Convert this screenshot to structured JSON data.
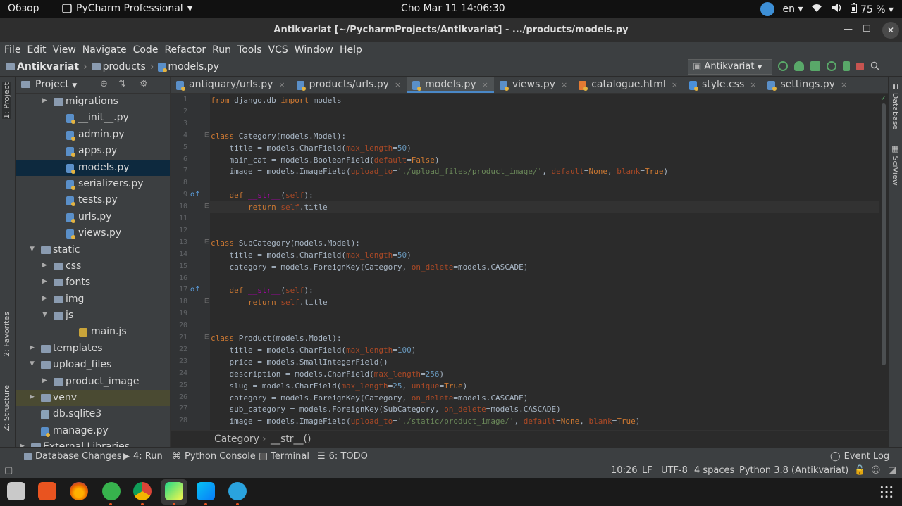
{
  "gnome": {
    "overview": "Обзор",
    "app_name": "PyCharm Professional",
    "clock": "Cho Mar 11  14:06:30",
    "lang": "en",
    "battery": "75 %"
  },
  "window": {
    "title": "Antikvariat [~/PycharmProjects/Antikvariat] - .../products/models.py"
  },
  "menu": [
    "File",
    "Edit",
    "View",
    "Navigate",
    "Code",
    "Refactor",
    "Run",
    "Tools",
    "VCS",
    "Window",
    "Help"
  ],
  "navbar": {
    "project": "Antikvariat",
    "folder": "products",
    "file": "models.py",
    "run_config": "Antikvariat"
  },
  "project_panel": {
    "title": "Project",
    "tree": [
      {
        "label": "migrations",
        "type": "folder",
        "level": 2,
        "expanded": false
      },
      {
        "label": "__init__.py",
        "type": "py",
        "level": 3
      },
      {
        "label": "admin.py",
        "type": "py",
        "level": 3
      },
      {
        "label": "apps.py",
        "type": "py",
        "level": 3
      },
      {
        "label": "models.py",
        "type": "py",
        "level": 3,
        "selected": true
      },
      {
        "label": "serializers.py",
        "type": "py",
        "level": 3
      },
      {
        "label": "tests.py",
        "type": "py",
        "level": 3
      },
      {
        "label": "urls.py",
        "type": "py",
        "level": 3
      },
      {
        "label": "views.py",
        "type": "py",
        "level": 3
      },
      {
        "label": "static",
        "type": "folder",
        "level": 1,
        "expanded": true
      },
      {
        "label": "css",
        "type": "folder",
        "level": 2,
        "expanded": false
      },
      {
        "label": "fonts",
        "type": "folder",
        "level": 2,
        "expanded": false
      },
      {
        "label": "img",
        "type": "folder",
        "level": 2,
        "expanded": false
      },
      {
        "label": "js",
        "type": "folder",
        "level": 2,
        "expanded": true
      },
      {
        "label": "main.js",
        "type": "js",
        "level": 4
      },
      {
        "label": "templates",
        "type": "folder",
        "level": 1,
        "expanded": false
      },
      {
        "label": "upload_files",
        "type": "folder",
        "level": 1,
        "expanded": true
      },
      {
        "label": "product_image",
        "type": "folder",
        "level": 2,
        "expanded": false
      },
      {
        "label": "venv",
        "type": "folder",
        "level": 1,
        "expanded": false,
        "venv": true
      },
      {
        "label": "db.sqlite3",
        "type": "db",
        "level": 1
      },
      {
        "label": "manage.py",
        "type": "py",
        "level": 1
      },
      {
        "label": "External Libraries",
        "type": "lib",
        "level": 0,
        "expanded": false
      }
    ]
  },
  "tabs": [
    {
      "label": "antiquary/urls.py",
      "active": false
    },
    {
      "label": "products/urls.py",
      "active": false
    },
    {
      "label": "models.py",
      "active": true
    },
    {
      "label": "views.py",
      "active": false
    },
    {
      "label": "catalogue.html",
      "active": false
    },
    {
      "label": "style.css",
      "active": false
    },
    {
      "label": "settings.py",
      "active": false
    }
  ],
  "code_lines": [
    "from django.db import models",
    "",
    "",
    "class Category(models.Model):",
    "    title = models.CharField(max_length=50)",
    "    main_cat = models.BooleanField(default=False)",
    "    image = models.ImageField(upload_to='./upload_files/product_image/', default=None, blank=True)",
    "",
    "    def __str__(self):",
    "        return self.title",
    "",
    "",
    "class SubCategory(models.Model):",
    "    title = models.CharField(max_length=50)",
    "    category = models.ForeignKey(Category, on_delete=models.CASCADE)",
    "",
    "    def __str__(self):",
    "        return self.title",
    "",
    "",
    "class Product(models.Model):",
    "    title = models.CharField(max_length=100)",
    "    price = models.SmallIntegerField()",
    "    description = models.CharField(max_length=256)",
    "    slug = models.CharField(max_length=25, unique=True)",
    "    category = models.ForeignKey(Category, on_delete=models.CASCADE)",
    "    sub_category = models.ForeignKey(SubCategory, on_delete=models.CASCADE)",
    "    image = models.ImageField(upload_to='./static/product_image/', default=None, blank=True)"
  ],
  "editor_breadcrumb": [
    "Category",
    "__str__()"
  ],
  "left_tools": [
    "1: Project",
    "2: Favorites",
    "Z: Structure"
  ],
  "right_tools": [
    "Database",
    "SciView"
  ],
  "bottom_tools": [
    {
      "label": "Database Changes"
    },
    {
      "label": "4: Run"
    },
    {
      "label": "Python Console"
    },
    {
      "label": "Terminal"
    },
    {
      "label": "6: TODO"
    }
  ],
  "event_log": "Event Log",
  "status": {
    "position": "10:26",
    "line_sep": "LF",
    "encoding": "UTF-8",
    "indent": "4 spaces",
    "interpreter": "Python 3.8 (Antikvariat)"
  }
}
